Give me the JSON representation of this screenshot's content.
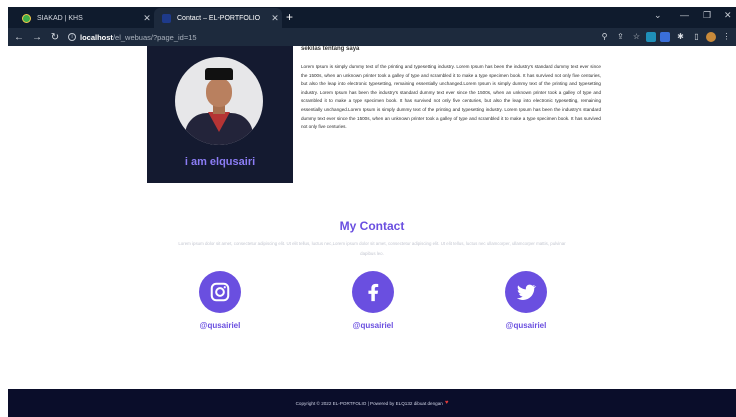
{
  "browser": {
    "tabs": [
      {
        "title": "SIAKAD | KHS",
        "active": false
      },
      {
        "title": "Contact – EL-PORTFOLIO",
        "active": true
      }
    ],
    "address": {
      "host": "localhost",
      "path": "/el_webuas/?page_id=15"
    }
  },
  "profile": {
    "name": "i am elqusairi"
  },
  "about": {
    "title": "sekilas tentang saya",
    "text": "Lorem Ipsum is simply dummy text of the printing and typesetting industry. Lorem Ipsum has been the industry's standard dummy text ever since the 1500s, when an unknown printer took a galley of type and scrambled it to make a type specimen book. It has survived not only five centuries, but also the leap into electronic typesetting, remaining essentially unchanged.Lorem Ipsum is simply dummy text of the printing and typesetting industry. Lorem Ipsum has been the industry's standard dummy text ever since the 1500s, when an unknown printer took a galley of type and scrambled it to make a type specimen book. It has survived not only five centuries, but also the leap into electronic typesetting, remaining essentially unchanged.Lorem Ipsum is simply dummy text of the printing and typesetting industry. Lorem Ipsum has been the industry's standard dummy text ever since the 1500s, when an unknown printer took a galley of type and scrambled it to make a type specimen book. It has survived not only five centuries."
  },
  "contact": {
    "title": "My Contact",
    "subtitle": "Lorem ipsum dolor sit amet, consectetur adipiscing elit. Ut elit tellus, luctus nec,Lorem ipsum dolor sit amet, consectetur adipiscing elit. Ut elit tellus, luctus nec ullamcorper, ullamcorper mattis, pulvinar dapibus leo.",
    "links": [
      {
        "icon": "instagram-icon",
        "handle": "@qusairiel"
      },
      {
        "icon": "facebook-icon",
        "handle": "@qusairiel"
      },
      {
        "icon": "twitter-icon",
        "handle": "@qusairiel"
      }
    ]
  },
  "footer": {
    "text": "Copyright © 2022 EL-PORTFOLIO | Powered by ELQ132 dibuat dengan"
  },
  "colors": {
    "accent": "#6a4fe0",
    "card": "#141a30",
    "footer": "#0a0d2a"
  }
}
